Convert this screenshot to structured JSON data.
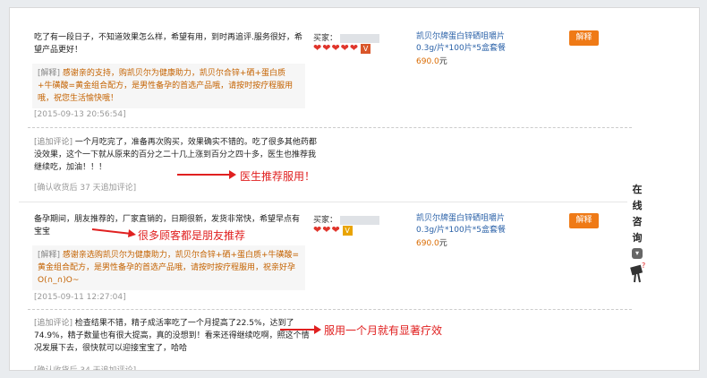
{
  "colors": {
    "accent": "#ef7a16",
    "link": "#2b62a8",
    "annotation": "#e02020",
    "price": "#d96a00",
    "explain_text": "#c46200"
  },
  "reviews": [
    {
      "comment": "吃了有一段日子，不知道效果怎么样，希望有用，到时再追评.服务很好，希望产品更好！",
      "explain_label": "[解释]",
      "explain_text": "感谢亲的支持，购凯贝尔为健康助力，凯贝尔合锌+硒+蛋白质+牛磺酸=黄金组合配方，是男性备孕的首选产品哦，请按时按疗程服用哦，祝您生活愉快哦！",
      "date": "[2015-09-13 20:56:54]",
      "add_label": "[追加评论]",
      "add_text": "一个月吃完了，准备再次购买，效果确实不错的。吃了很多其他药都没效果，这个一下就从原来的百分之二十几上涨到百分之四十多，医生也推荐我继续吃，加油！！！",
      "status": "[确认收货后 37 天追加评论]",
      "buyer_label": "买家：",
      "product": "凯贝尔牌蛋白锌硒咀嚼片",
      "spec": "0.3g/片*100片*5盒套餐",
      "price": "690.0",
      "price_unit": "元",
      "explain_button": "解释",
      "hearts": 5,
      "badge": "orange"
    },
    {
      "comment": "备孕期间，朋友推荐的，厂家直销的，日期很新，发货非常快，希望早点有宝宝",
      "explain_label": "[解释]",
      "explain_text": "感谢亲选购凯贝尔为健康助力，凯贝尔合锌+硒+蛋白质+牛磺酸=黄金组合配方，是男性备孕的首选产品哦，请按时按疗程服用，祝亲好孕O(∩_∩)O~",
      "date": "[2015-09-11 12:27:04]",
      "add_label": "[追加评论]",
      "add_text": "检查结果不错，精子成活率吃了一个月提高了22.5%，达到了74.9%，精子数量也有很大提高，真的没想到！看来还得继续吃啊，照这个情况发展下去，很快就可以迎接宝宝了，哈哈",
      "status": "[确认收货后 34 天追加评论]",
      "buyer_label": "买家：",
      "product": "凯贝尔牌蛋白锌硒咀嚼片",
      "spec": "0.3g/片*100片*5盒套餐",
      "price": "690.0",
      "price_unit": "元",
      "explain_button": "解释",
      "hearts": 3,
      "badge": "yellow"
    }
  ],
  "annotations": [
    "医生推荐服用！",
    "很多顾客都是朋友推荐",
    "服用一个月就有显著疗效"
  ],
  "online_consult": [
    "在",
    "线",
    "咨",
    "询"
  ]
}
